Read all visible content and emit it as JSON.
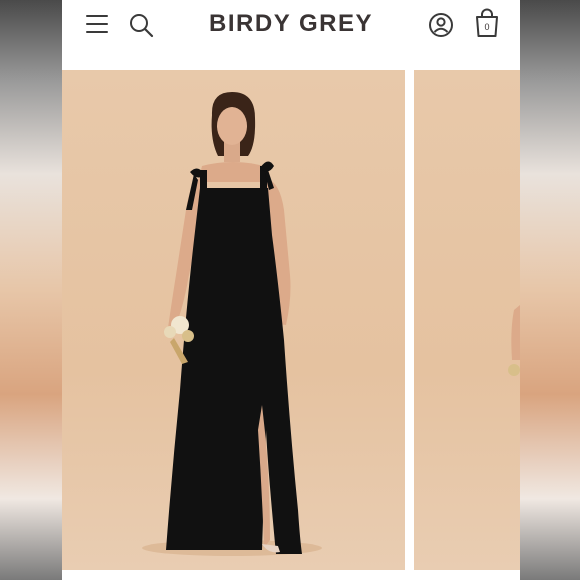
{
  "header": {
    "brand": "BIRDY GREY",
    "menu_icon": "hamburger-menu-icon",
    "search_icon": "search-icon",
    "account_icon": "account-icon",
    "cart_icon": "shopping-bag-icon",
    "cart_count": "0"
  },
  "gallery": {
    "images": [
      {
        "description": "model-black-gown-front",
        "active": true
      },
      {
        "description": "model-black-gown-alt-view",
        "active": false
      }
    ]
  },
  "colors": {
    "brand_text": "#3a3434",
    "backdrop": "#e5c2a0",
    "dress": "#111111"
  }
}
